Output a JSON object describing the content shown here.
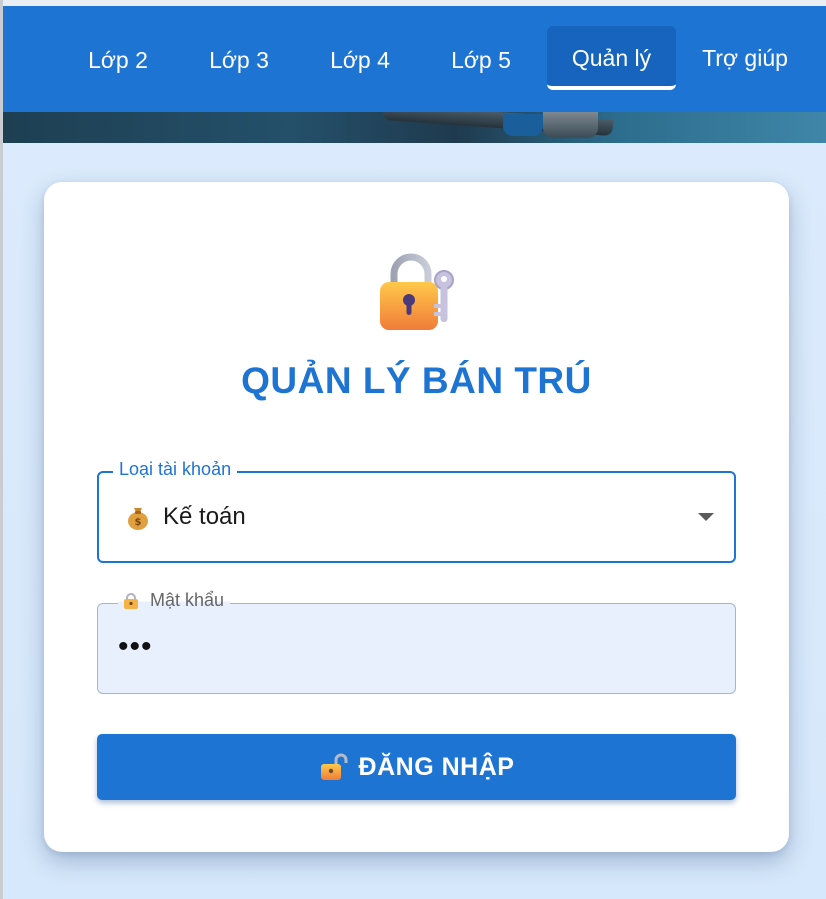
{
  "nav": {
    "items": [
      {
        "label": "Lớp 2"
      },
      {
        "label": "Lớp 3"
      },
      {
        "label": "Lớp 4"
      },
      {
        "label": "Lớp 5"
      },
      {
        "label": "Quản lý",
        "active": true
      },
      {
        "label": "Trợ giúp"
      }
    ]
  },
  "login": {
    "title": "QUẢN LÝ BÁN TRÚ",
    "title_icon": "lock-with-key-icon",
    "account_type": {
      "label": "Loại tài khoản",
      "selected_value": "Kế toán",
      "selected_icon": "money-bag-icon"
    },
    "password": {
      "label": "Mật khẩu",
      "label_icon": "lock-icon",
      "value": "•••"
    },
    "submit": {
      "label": "ĐĂNG NHẬP",
      "icon": "unlock-icon"
    }
  },
  "colors": {
    "primary": "#1e74d2",
    "nav_active": "#1664bd",
    "background": "#dbeafb",
    "password_fill": "#e8f0fe"
  }
}
